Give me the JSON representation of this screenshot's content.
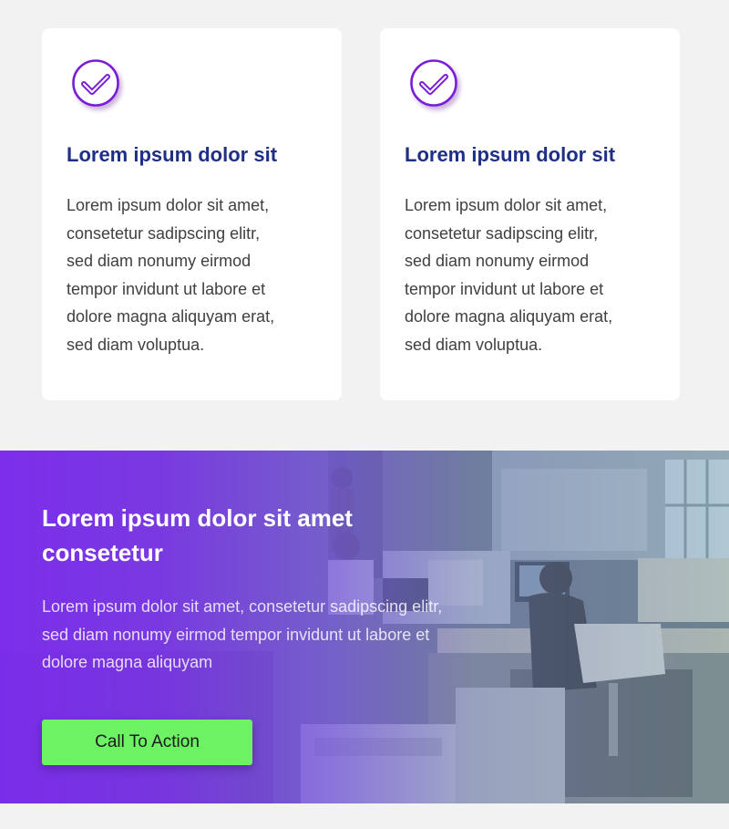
{
  "features": [
    {
      "icon": "check-circle-icon",
      "title": "Lorem ipsum dolor sit",
      "body": "Lorem ipsum dolor sit amet,\nconsetetur sadipscing elitr,\nsed diam nonumy eirmod\ntempor invidunt ut labore et\ndolore magna aliquyam erat,\nsed diam voluptua."
    },
    {
      "icon": "check-circle-icon",
      "title": "Lorem ipsum dolor sit",
      "body": "Lorem ipsum dolor sit amet,\nconsetetur sadipscing elitr,\nsed diam nonumy eirmod\ntempor invidunt ut labore et\ndolore magna aliquyam erat,\nsed diam voluptua."
    }
  ],
  "hero": {
    "title": "Lorem ipsum dolor sit amet consetetur",
    "text": "Lorem ipsum dolor sit amet, consetetur sadipscing elitr, sed diam nonumy eirmod tempor invidunt ut labore et dolore magna aliquyam",
    "cta_label": "Call To Action",
    "background_image": "office-workspace-photo"
  },
  "colors": {
    "page_background": "#f2f2f2",
    "card_title": "#1f2f86",
    "body_text": "#404040",
    "icon_purple": "#7a1fd6",
    "hero_gradient_start": "#7c2cee",
    "cta_green": "#6cf263"
  }
}
